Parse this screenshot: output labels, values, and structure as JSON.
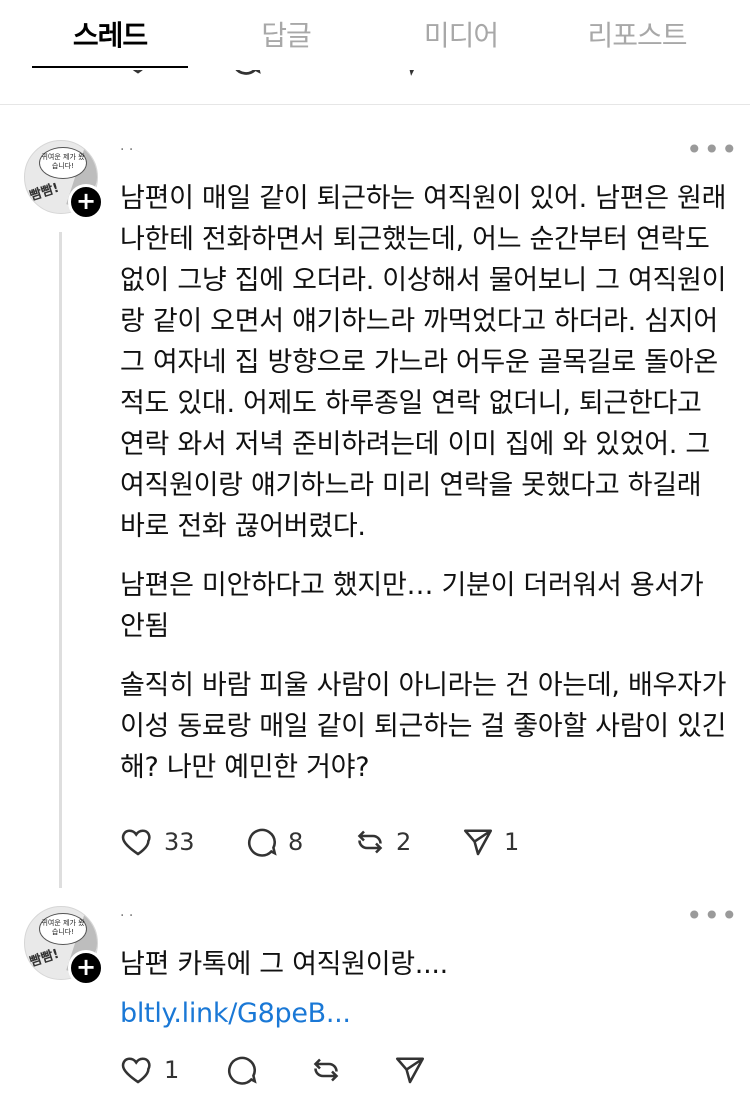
{
  "tabs": [
    {
      "label": "스레드",
      "active": true
    },
    {
      "label": "답글",
      "active": false
    },
    {
      "label": "미디어",
      "active": false
    },
    {
      "label": "리포스트",
      "active": false
    }
  ],
  "posts": [
    {
      "avatar_text": "귀여운 제가 왔습니다!",
      "avatar_shout": "빰빰!",
      "username": "·  ·",
      "paragraphs": [
        "남편이 매일 같이 퇴근하는 여직원이 있어. 남편은 원래 나한테 전화하면서 퇴근했는데, 어느 순간부터 연락도 없이 그냥 집에 오더라. 이상해서 물어보니 그 여직원이랑 같이 오면서 얘기하느라 까먹었다고 하더라. 심지어 그 여자네 집 방향으로 가느라 어두운 골목길로 돌아온 적도 있대. 어제도 하루종일 연락 없더니, 퇴근한다고 연락 와서 저녁 준비하려는데 이미 집에 와 있었어. 그 여직원이랑 얘기하느라 미리 연락을 못했다고 하길래 바로 전화 끊어버렸다.",
        "남편은 미안하다고 했지만… 기분이 더러워서 용서가 안됨",
        "솔직히 바람 피울 사람이 아니라는 건 아는데, 배우자가 이성 동료랑 매일 같이 퇴근하는 걸 좋아할 사람이 있긴 해? 나만 예민한 거야?"
      ],
      "counts": {
        "likes": "33",
        "replies": "8",
        "reposts": "2",
        "shares": "1"
      }
    },
    {
      "avatar_text": "귀여운 제가 왔습니다!",
      "avatar_shout": "빰빰!",
      "username": "·  ·",
      "text": "남편 카톡에 그 여직원이랑....",
      "link": "bltly.link/G8peB...",
      "counts": {
        "likes": "1"
      }
    }
  ],
  "icons": [
    "heart-icon",
    "comment-icon",
    "repost-icon",
    "share-icon",
    "more-icon",
    "plus-icon"
  ],
  "colors": {
    "link": "#1a78d6",
    "muted": "#a8a8a8"
  }
}
